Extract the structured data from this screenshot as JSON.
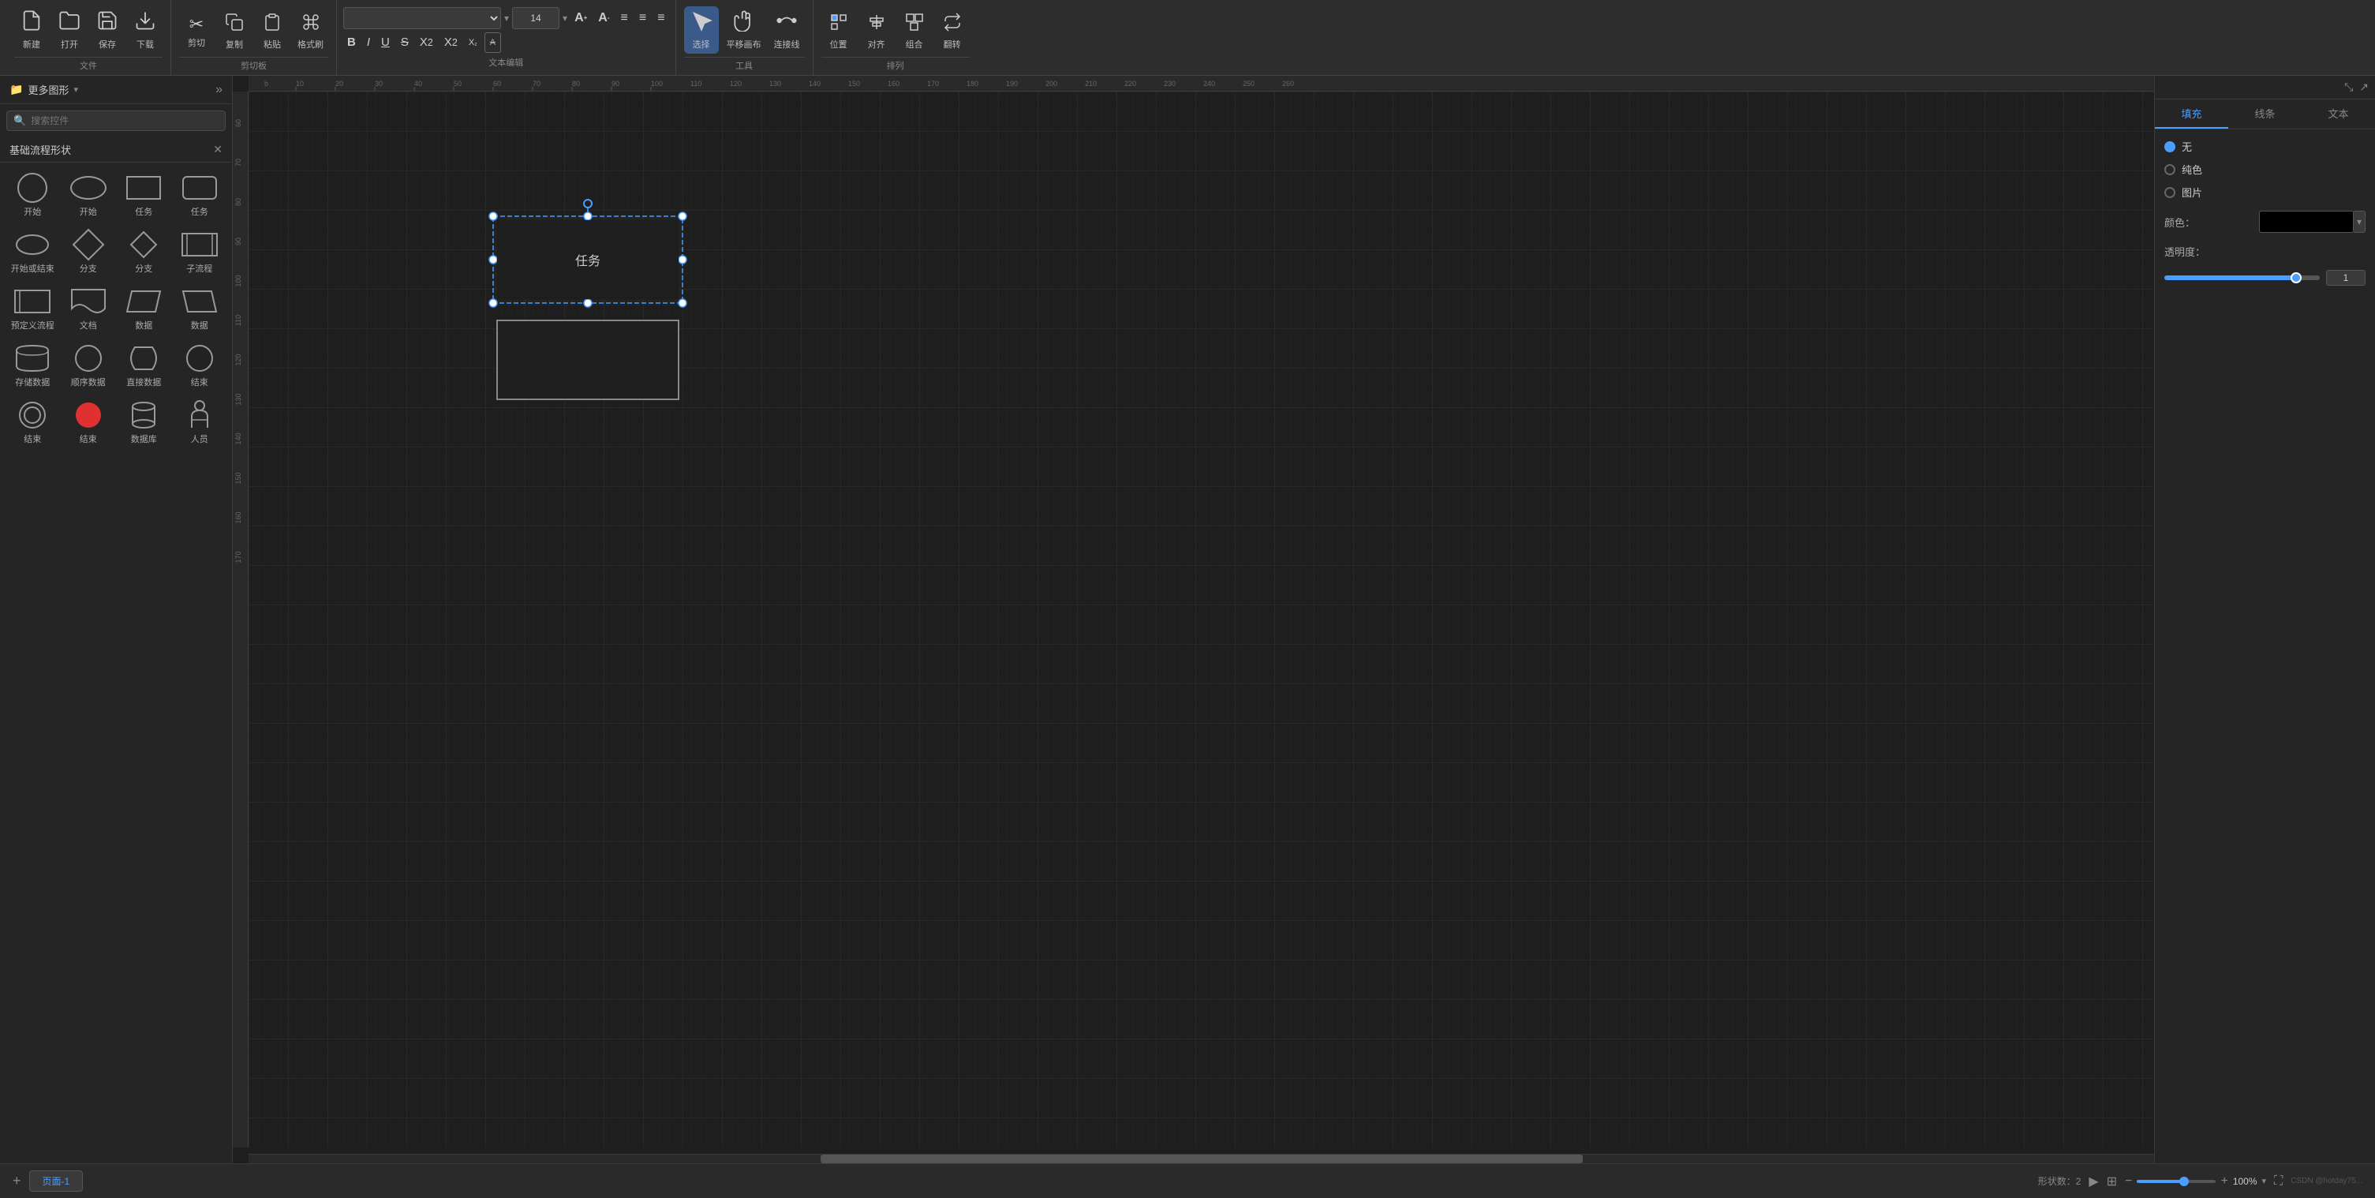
{
  "toolbar": {
    "file_group_label": "文件",
    "new_label": "新建",
    "open_label": "打开",
    "save_label": "保存",
    "download_label": "下载",
    "clipboard_group_label": "剪切板",
    "cut_label": "剪切",
    "copy_label": "复制",
    "paste_label": "粘贴",
    "format_brush_label": "格式刷",
    "text_edit_group_label": "文本编辑",
    "font_placeholder": "",
    "font_size": "14",
    "font_size_increase": "A+",
    "font_size_decrease": "A-",
    "align_left": "≡",
    "align_center": "≡",
    "align_right": "≡",
    "bold_label": "B",
    "italic_label": "I",
    "underline_label": "U",
    "strikethrough_label": "S",
    "superscript_label": "X²",
    "subscript_label": "X₂",
    "subsubscript_label": "X₂",
    "eraser_label": "A",
    "tools_group_label": "工具",
    "select_label": "选择",
    "pan_label": "平移画布",
    "connect_label": "连接线",
    "arrange_group_label": "排列",
    "position_label": "位置",
    "align_label": "对齐",
    "group_label": "组合",
    "flip_label": "翻转"
  },
  "sidebar": {
    "more_shapes_label": "更多图形",
    "search_placeholder": "搜索控件",
    "panel_title": "基础流程形状",
    "shapes": [
      {
        "label": "开始",
        "type": "circle"
      },
      {
        "label": "开始",
        "type": "oval"
      },
      {
        "label": "任务",
        "type": "rect"
      },
      {
        "label": "任务",
        "type": "rect-round"
      },
      {
        "label": "开始或结束",
        "type": "circle-sm"
      },
      {
        "label": "分支",
        "type": "diamond"
      },
      {
        "label": "分支",
        "type": "diamond-sm"
      },
      {
        "label": "子流程",
        "type": "subflow"
      },
      {
        "label": "预定义流程",
        "type": "predefined"
      },
      {
        "label": "文档",
        "type": "doc"
      },
      {
        "label": "数据",
        "type": "parallelogram-right"
      },
      {
        "label": "数据",
        "type": "parallelogram-left"
      },
      {
        "label": "存储数据",
        "type": "storage"
      },
      {
        "label": "顺序数据",
        "type": "seq-data"
      },
      {
        "label": "直接数据",
        "type": "direct-data"
      },
      {
        "label": "结束",
        "type": "circle-filled-black"
      },
      {
        "label": "结束",
        "type": "circle-outline-sm"
      },
      {
        "label": "结束",
        "type": "circle-filled-red"
      },
      {
        "label": "数据库",
        "type": "database"
      },
      {
        "label": "人员",
        "type": "person"
      }
    ]
  },
  "canvas": {
    "shape1_label": "任务",
    "shape2_label": ""
  },
  "right_panel": {
    "tabs": [
      "填充",
      "线条",
      "文本"
    ],
    "active_tab": "填充",
    "fill_options": [
      "无",
      "纯色",
      "图片"
    ],
    "selected_fill": "无",
    "color_label": "颜色：",
    "opacity_label": "透明度：",
    "opacity_value": "1",
    "icons": [
      "expand",
      "share"
    ]
  },
  "statusbar": {
    "add_page_title": "+",
    "page_label": "页面-1",
    "shape_count_label": "形状数：2",
    "zoom_label": "100%",
    "watermark": "CSDN @hotday75..."
  }
}
